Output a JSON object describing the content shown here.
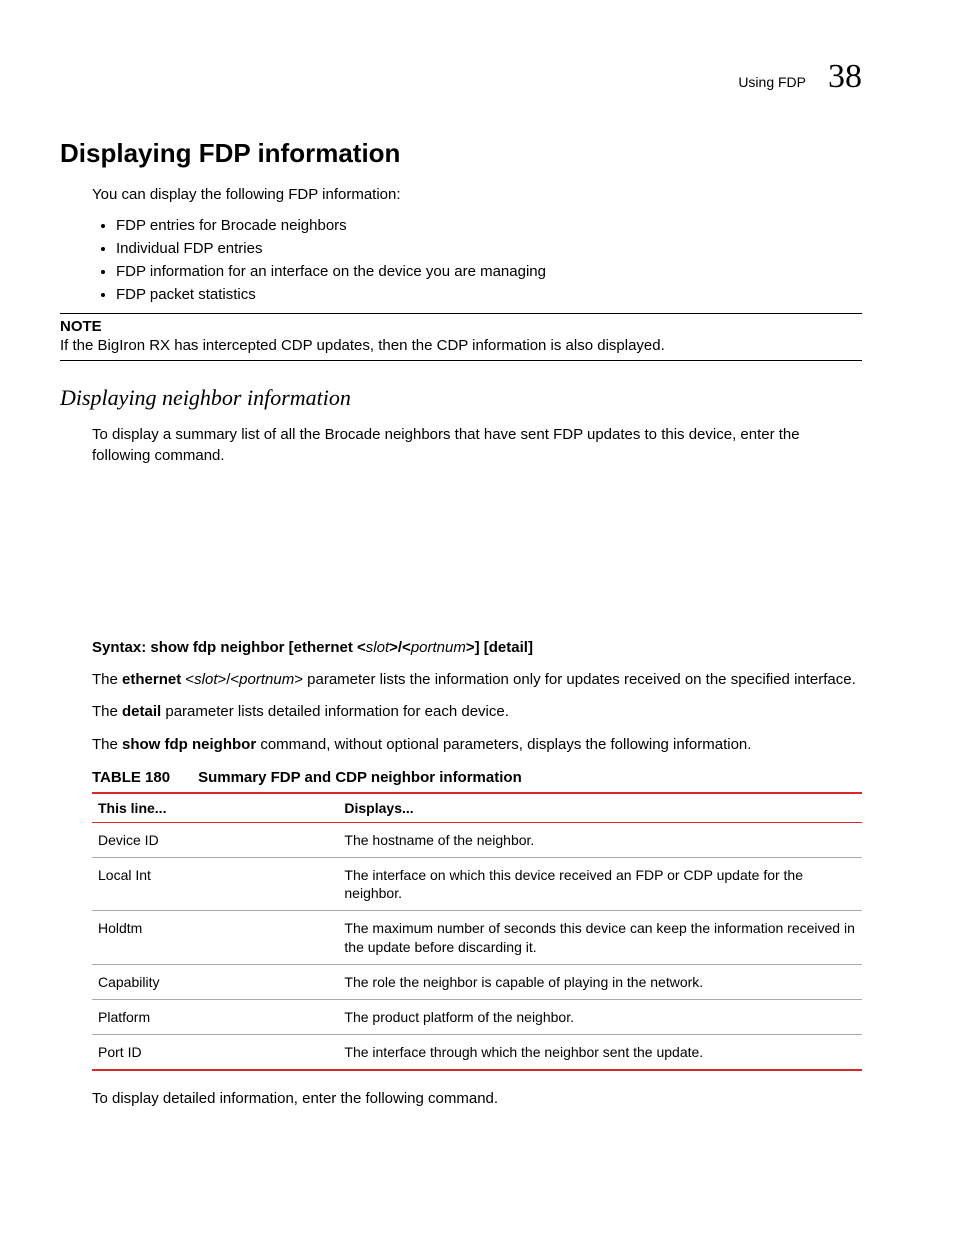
{
  "header": {
    "label": "Using FDP",
    "chapter": "38"
  },
  "h1": "Displaying FDP information",
  "intro": "You can display the following FDP information:",
  "bullets": [
    "FDP entries for Brocade neighbors",
    "Individual FDP entries",
    "FDP information for an interface on the device you are managing",
    "FDP packet statistics"
  ],
  "note": {
    "label": "NOTE",
    "text": "If the BigIron RX has intercepted CDP updates, then the CDP information is also displayed."
  },
  "h2": "Displaying neighbor information",
  "p_after_h2": "To display a summary list of all the Brocade neighbors that have sent FDP updates to this device, enter the following command.",
  "syntax": {
    "lead": "Syntax:  show fdp neighbor [ethernet <",
    "slot": "slot",
    "mid": ">/<",
    "portnum": "portnum",
    "end": ">] [detail]"
  },
  "p_eth_1": "The ",
  "p_eth_b": "ethernet",
  "p_eth_i1": " <",
  "p_eth_slot": "slot",
  "p_eth_i2": ">/<",
  "p_eth_port": "portnum",
  "p_eth_i3": ">",
  "p_eth_rest": " parameter lists the information only for updates received on the specified interface.",
  "p_detail_1": "The ",
  "p_detail_b": "detail",
  "p_detail_rest": " parameter lists detailed information for each device.",
  "p_show_1": "The ",
  "p_show_b": "show fdp neighbor",
  "p_show_rest": " command, without optional parameters, displays the following information.",
  "table": {
    "num": "TABLE 180",
    "title": "Summary FDP and CDP neighbor information",
    "head_a": "This line...",
    "head_b": "Displays...",
    "rows": [
      {
        "a": "Device ID",
        "b": "The hostname of the neighbor."
      },
      {
        "a": "Local Int",
        "b": "The interface on which this device received an FDP or CDP update for the neighbor."
      },
      {
        "a": "Holdtm",
        "b": "The maximum number of seconds this device can keep the information received in the update before discarding it."
      },
      {
        "a": "Capability",
        "b": "The role the neighbor is capable of playing in the network."
      },
      {
        "a": "Platform",
        "b": "The product platform of the neighbor."
      },
      {
        "a": "Port ID",
        "b": "The interface through which the neighbor sent the update."
      }
    ]
  },
  "p_after_table": "To display detailed information, enter the following command."
}
